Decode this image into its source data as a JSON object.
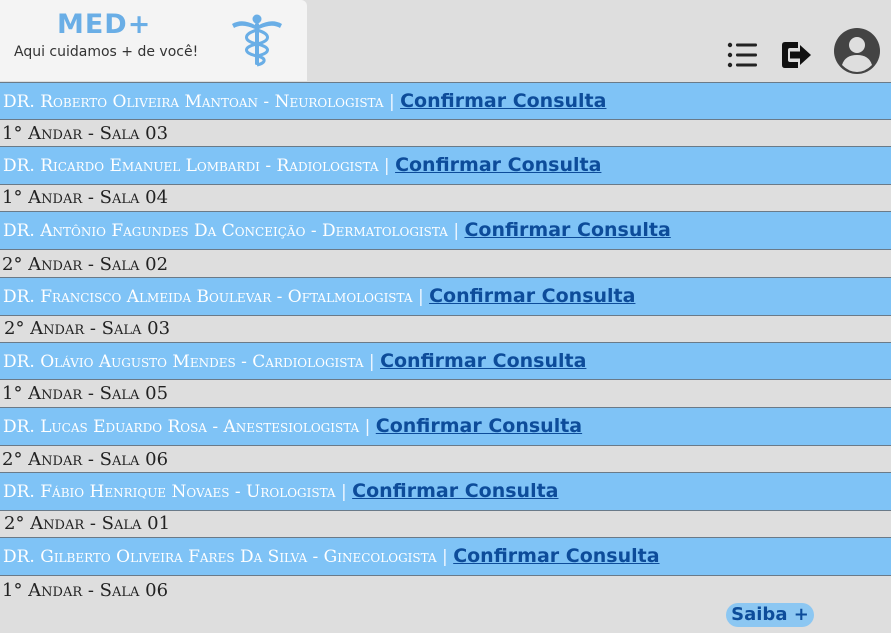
{
  "header": {
    "brand": "MED+",
    "tagline": "Aqui cuidamos + de você!",
    "icons": [
      "caduceus-icon",
      "menu-list-icon",
      "logout-icon",
      "user-avatar-icon"
    ]
  },
  "doctors": [
    {
      "name": "DR. Roberto Oliveira Mantoan - Neurologista",
      "separator": "|",
      "action": "Confirmar Consulta",
      "location": "1° Andar - Sala 03"
    },
    {
      "name": "DR. Ricardo Emanuel Lombardi - Radiologista",
      "separator": "|",
      "action": "Confirmar Consulta",
      "location": "1° Andar - Sala 04"
    },
    {
      "name": "DR. Antônio Fagundes Da Conceição - Dermatologista",
      "separator": "|",
      "action": "Confirmar Consulta",
      "location": "2° Andar - Sala 02"
    },
    {
      "name": "DR. Francisco Almeida Boulevar - Oftalmologista",
      "separator": "|",
      "action": "Confirmar Consulta",
      "location": "2° Andar - Sala 03"
    },
    {
      "name": "DR. Olávio Augusto Mendes - Cardiologista",
      "separator": "|",
      "action": "Confirmar Consulta",
      "location": "1° Andar - Sala 05"
    },
    {
      "name": "DR. Lucas Eduardo Rosa - Anestesiologista",
      "separator": "|",
      "action": "Confirmar Consulta",
      "location": "2° Andar - Sala 06"
    },
    {
      "name": "DR. Fábio Henrique Novaes - Urologista",
      "separator": "|",
      "action": "Confirmar Consulta",
      "location": "2° Andar - Sala 01"
    },
    {
      "name": "DR. Gilberto Oliveira Fares Da Silva - Ginecologista",
      "separator": "|",
      "action": "Confirmar Consulta",
      "location": "1° Andar - Sala 06"
    }
  ],
  "footer": {
    "more_button": "Saiba +"
  },
  "colors": {
    "accent": "#7fc3f6",
    "link": "#0d4c9a",
    "brand": "#6aaee6",
    "background": "#dedede"
  }
}
